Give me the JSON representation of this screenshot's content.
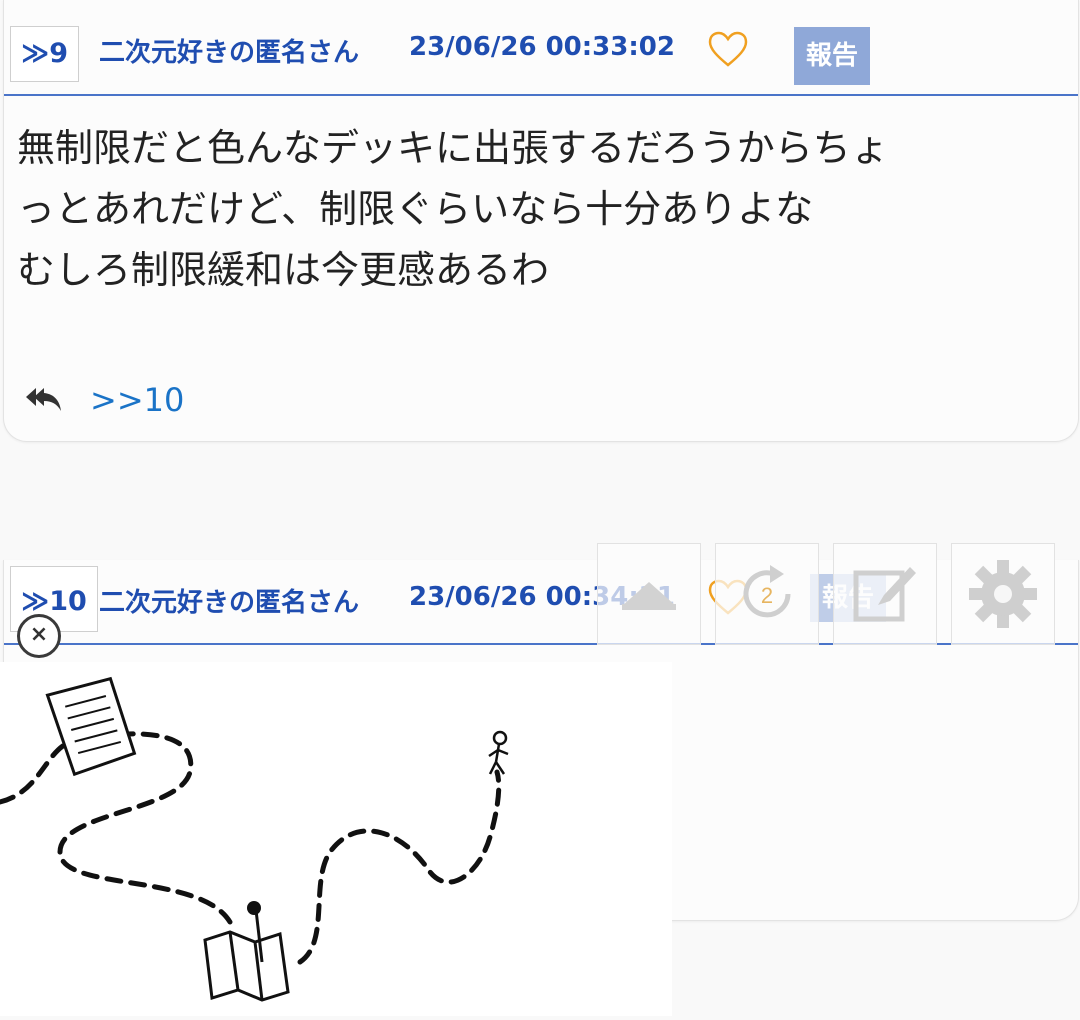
{
  "posts": [
    {
      "number": "≫9",
      "author": "二次元好きの匿名さん",
      "datetime": "23/06/26 00:33:02",
      "report_label": "報告",
      "body_lines": [
        "無制限だと色んなデッキに出張するだろうからちょ",
        "っとあれだけど、制限ぐらいなら十分ありよな",
        "むしろ制限緩和は今更感あるわ"
      ],
      "replies": ">>10"
    },
    {
      "number": "≫10",
      "author": "二次元好きの匿名さん",
      "datetime": "23/06/26 00:34:31",
      "report_label": "報告"
    }
  ],
  "floating_toolbar": {
    "reload_count": "2",
    "icons": [
      "scroll-top-icon",
      "reload-icon",
      "compose-icon",
      "settings-icon"
    ]
  },
  "ad": {
    "close_symbol": "×"
  },
  "colors": {
    "link_blue": "#1f4db0",
    "reply_link_blue": "#1a73c7",
    "report_bg": "#8fa8d8",
    "heart_orange": "#f0a020",
    "header_rule": "#4a74c9"
  }
}
